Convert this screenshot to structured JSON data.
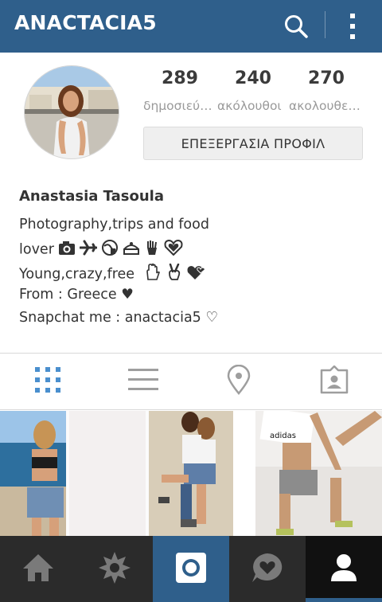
{
  "header": {
    "username": "ANACTACIA5"
  },
  "stats": [
    {
      "count": "289",
      "label": "δημοσιεύσεις"
    },
    {
      "count": "240",
      "label": "ακόλουθοι"
    },
    {
      "count": "270",
      "label": "ακολουθείτε"
    }
  ],
  "edit_profile_label": "ΕΠΕΞΕΡΓΑΣΙΑ ΠΡΟΦΙΛ",
  "profile": {
    "full_name": "Anastasia Tasoula",
    "bio": [
      "Photography,trips and food",
      "lover",
      "Young,crazy,free",
      "From : Greece ♥",
      "Snapchat me : anactacia5 ♡"
    ]
  },
  "tabs": [
    "grid-view",
    "list-view",
    "location-view",
    "tagged-view"
  ],
  "bottom_nav": [
    "home",
    "explore",
    "camera",
    "activity",
    "profile"
  ],
  "colors": {
    "brand": "#2f5f8b",
    "bottom_bar": "#2b2b2b"
  }
}
